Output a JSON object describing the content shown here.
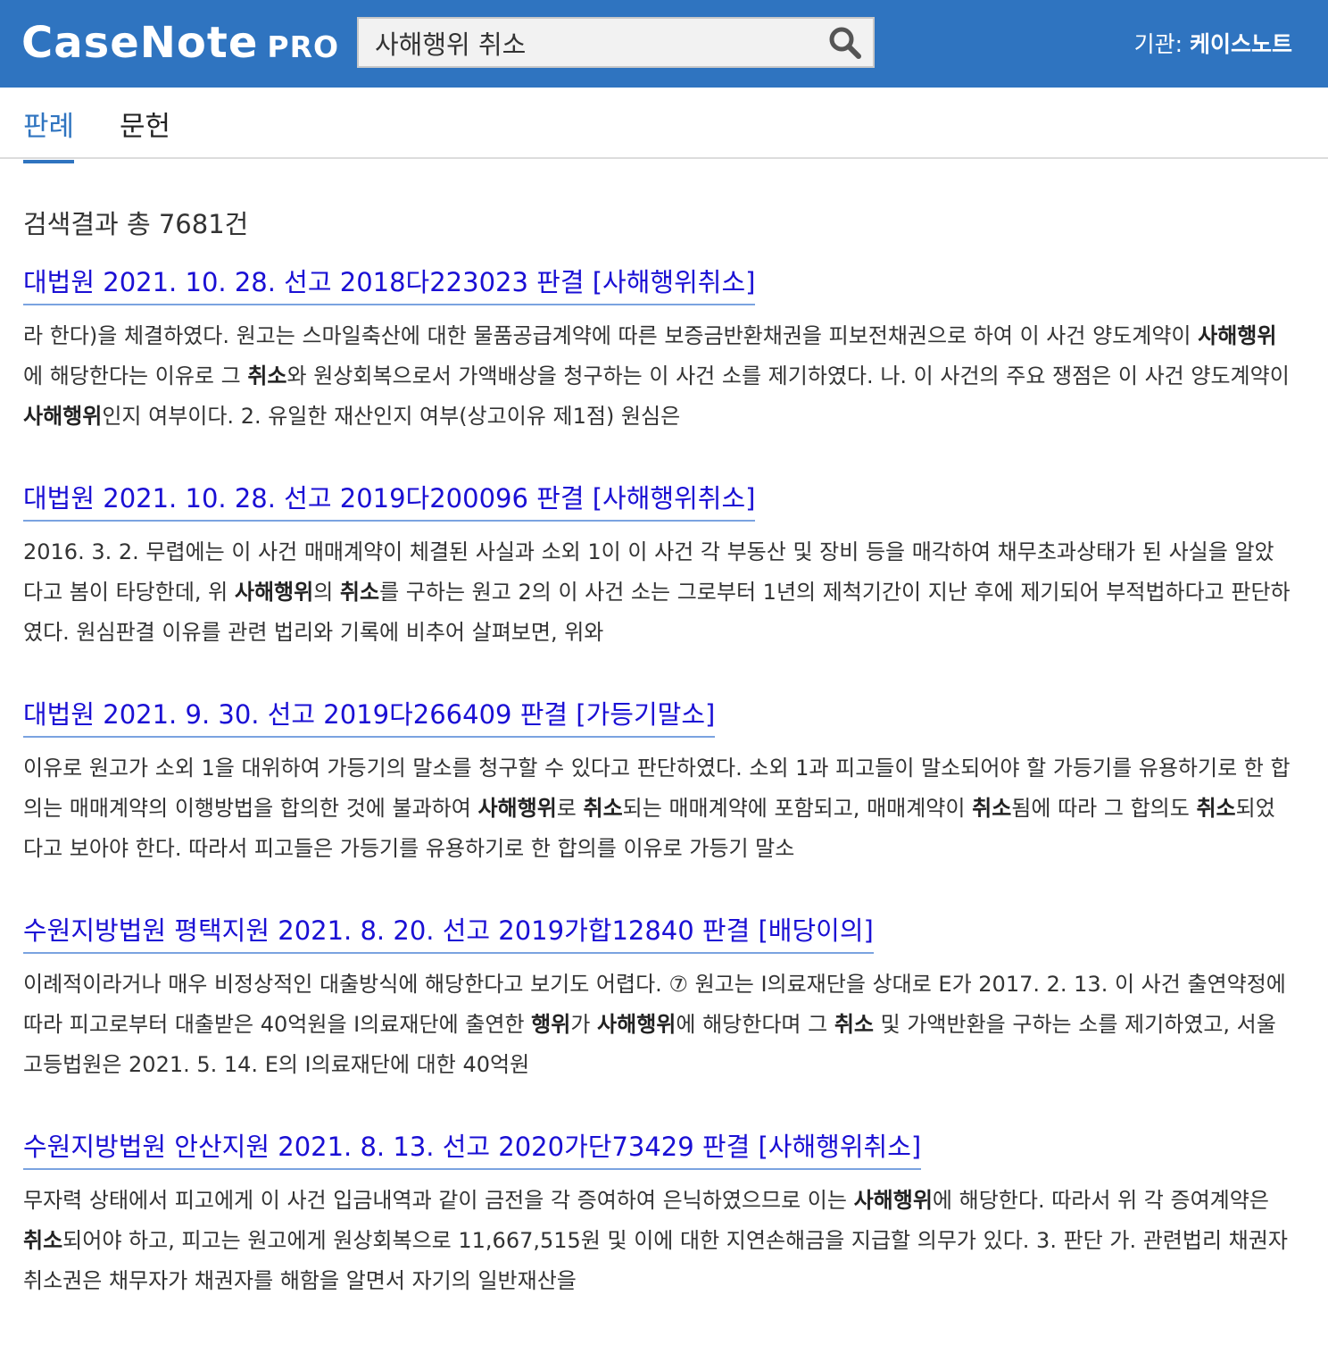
{
  "header": {
    "logo_main": "CaseNote",
    "logo_sub": "PRO",
    "search_value": "사해행위 취소",
    "org_label": "기관: ",
    "org_name": "케이스노트"
  },
  "tabs": [
    {
      "label": "판례",
      "active": true
    },
    {
      "label": "문헌",
      "active": false
    }
  ],
  "result_count": "검색결과 총 7681건",
  "results": [
    {
      "title": "대법원 2021. 10. 28. 선고 2018다223023 판결 [사해행위취소]",
      "snippet": [
        {
          "t": "라 한다)을 체결하였다. 원고는 스마일축산에 대한 물품공급계약에 따른 보증금반환채권을 피보전채권으로 하여 이 사건 양도계약이 "
        },
        {
          "t": "사해행위",
          "b": true
        },
        {
          "t": "에 해당한다는 이유로 그 "
        },
        {
          "t": "취소",
          "b": true
        },
        {
          "t": "와 원상회복으로서 가액배상을 청구하는 이 사건 소를 제기하였다. 나. 이 사건의 주요 쟁점은 이 사건 양도계약이 "
        },
        {
          "t": "사해행위",
          "b": true
        },
        {
          "t": "인지 여부이다. 2. 유일한 재산인지 여부(상고이유 제1점) 원심은"
        }
      ]
    },
    {
      "title": "대법원 2021. 10. 28. 선고 2019다200096 판결 [사해행위취소]",
      "snippet": [
        {
          "t": "2016. 3. 2. 무렵에는 이 사건 매매계약이 체결된 사실과 소외 1이 이 사건 각 부동산 및 장비 등을 매각하여 채무초과상태가 된 사실을 알았다고 봄이 타당한데, 위 "
        },
        {
          "t": "사해행위",
          "b": true
        },
        {
          "t": "의 "
        },
        {
          "t": "취소",
          "b": true
        },
        {
          "t": "를 구하는 원고 2의 이 사건 소는 그로부터 1년의 제척기간이 지난 후에 제기되어 부적법하다고 판단하였다. 원심판결 이유를 관련 법리와 기록에 비추어 살펴보면, 위와"
        }
      ]
    },
    {
      "title": "대법원 2021. 9. 30. 선고 2019다266409 판결 [가등기말소]",
      "snippet": [
        {
          "t": "이유로 원고가 소외 1을 대위하여 가등기의 말소를 청구할 수 있다고 판단하였다. 소외 1과 피고들이 말소되어야 할 가등기를 유용하기로 한 합의는 매매계약의 이행방법을 합의한 것에 불과하여 "
        },
        {
          "t": "사해행위",
          "b": true
        },
        {
          "t": "로 "
        },
        {
          "t": "취소",
          "b": true
        },
        {
          "t": "되는 매매계약에 포함되고, 매매계약이 "
        },
        {
          "t": "취소",
          "b": true
        },
        {
          "t": "됨에 따라 그 합의도 "
        },
        {
          "t": "취소",
          "b": true
        },
        {
          "t": "되었다고 보아야 한다. 따라서 피고들은 가등기를 유용하기로 한 합의를 이유로 가등기 말소"
        }
      ]
    },
    {
      "title": "수원지방법원 평택지원 2021. 8. 20. 선고 2019가합12840 판결 [배당이의]",
      "snippet": [
        {
          "t": "이례적이라거나 매우 비정상적인 대출방식에 해당한다고 보기도 어렵다. ⑦ 원고는 I의료재단을 상대로 E가 2017. 2. 13. 이 사건 출연약정에 따라 피고로부터 대출받은 40억원을 I의료재단에 출연한 "
        },
        {
          "t": "행위",
          "b": true
        },
        {
          "t": "가 "
        },
        {
          "t": "사해행위",
          "b": true
        },
        {
          "t": "에 해당한다며 그 "
        },
        {
          "t": "취소",
          "b": true
        },
        {
          "t": " 및 가액반환을 구하는 소를 제기하였고, 서울고등법원은 2021. 5. 14. E의 I의료재단에 대한 40억원"
        }
      ]
    },
    {
      "title": "수원지방법원 안산지원 2021. 8. 13. 선고 2020가단73429 판결 [사해행위취소]",
      "snippet": [
        {
          "t": "무자력 상태에서 피고에게 이 사건 입금내역과 같이 금전을 각 증여하여 은닉하였으므로 이는 "
        },
        {
          "t": "사해행위",
          "b": true
        },
        {
          "t": "에 해당한다. 따라서 위 각 증여계약은 "
        },
        {
          "t": "취소",
          "b": true
        },
        {
          "t": "되어야 하고, 피고는 원고에게 원상회복으로 11,667,515원 및 이에 대한 지연손해금을 지급할 의무가 있다. 3. 판단 가. 관련법리 채권자취소권은 채무자가 채권자를 해함을 알면서 자기의 일반재산을"
        }
      ]
    }
  ]
}
